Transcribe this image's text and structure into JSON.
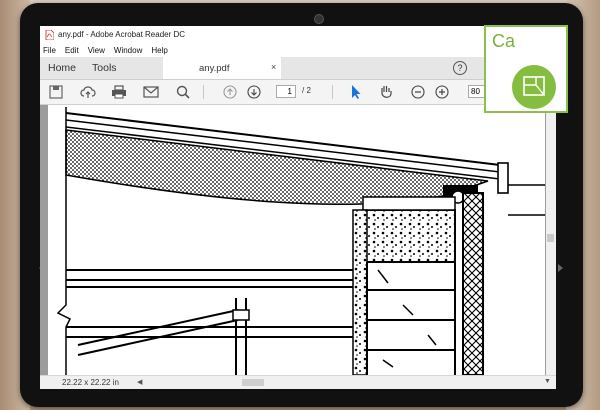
{
  "window": {
    "title": "any.pdf - Adobe Acrobat Reader DC"
  },
  "menu": {
    "items": [
      {
        "label": "File"
      },
      {
        "label": "Edit"
      },
      {
        "label": "View"
      },
      {
        "label": "Window"
      },
      {
        "label": "Help"
      }
    ]
  },
  "tabs": {
    "home": "Home",
    "tools": "Tools",
    "document": "any.pdf",
    "close": "×",
    "help": "?"
  },
  "toolbar": {
    "icons": [
      "save-icon",
      "upload-icon",
      "print-icon",
      "email-icon",
      "search-icon",
      "page-up-icon",
      "page-down-icon",
      "select-cursor-icon",
      "hand-icon",
      "zoom-out-icon",
      "zoom-in-icon"
    ],
    "page_current": "1",
    "page_total": "/ 2",
    "zoom": "80"
  },
  "status": {
    "page_size": "22.22 x 22.22 in"
  },
  "badge": {
    "text": "Ca",
    "border_color": "#8bc04a",
    "fill_color": "#84bd3f"
  }
}
